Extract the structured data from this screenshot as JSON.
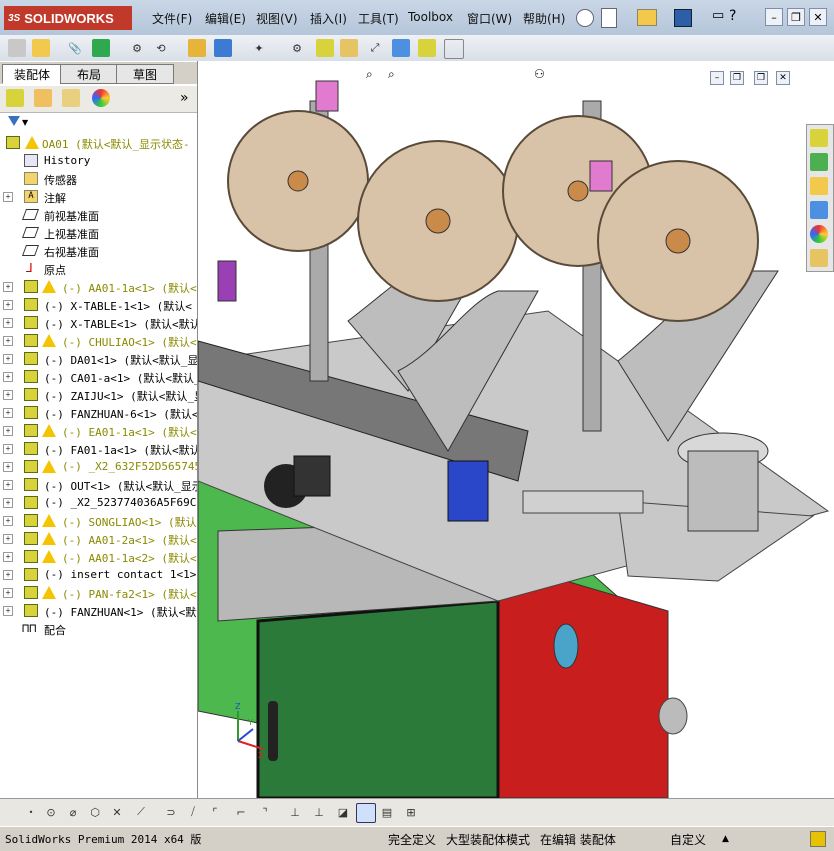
{
  "app": {
    "logo_text": "SOLIDWORKS",
    "logo_prefix": "3S"
  },
  "menu": [
    "文件(F)",
    "编辑(E)",
    "视图(V)",
    "插入(I)",
    "工具(T)",
    "Toolbox",
    "窗口(W)",
    "帮助(H)"
  ],
  "window_buttons": {
    "help": "?",
    "minimize": "–",
    "restore": "❐",
    "close": "✕"
  },
  "tabs": [
    "装配体",
    "布局",
    "草图"
  ],
  "panel_more": "»",
  "tree": {
    "root": "OA01  (默认<默认_显示状态-",
    "features": [
      "History",
      "传感器",
      "注解",
      "前视基准面",
      "上视基准面",
      "右视基准面",
      "原点"
    ],
    "components": [
      {
        "label": "(-) AA01-1a<1> (默认<默",
        "warn": true
      },
      {
        "label": "(-) X-TABLE-1<1> (默认<",
        "warn": false
      },
      {
        "label": "(-) X-TABLE<1> (默认<默认_",
        "warn": false
      },
      {
        "label": "(-) CHULIAO<1> (默认<默认",
        "warn": true
      },
      {
        "label": "(-) DA01<1> (默认<默认_显",
        "warn": false
      },
      {
        "label": "(-) CA01-a<1> (默认<默认_",
        "warn": false
      },
      {
        "label": "(-) ZAIJU<1> (默认<默认_显",
        "warn": false
      },
      {
        "label": "(-) FANZHUAN-6<1> (默认<默",
        "warn": false
      },
      {
        "label": "(-) EA01-1a<1> (默认<默认",
        "warn": true
      },
      {
        "label": "(-) FA01-1a<1> (默认<默认_",
        "warn": false
      },
      {
        "label": "(-) _X2_632F52D5657452",
        "warn": true
      },
      {
        "label": "(-) OUT<1> (默认<默认_显示",
        "warn": false
      },
      {
        "label": "(-) _X2_523774036A5F69CB_",
        "warn": false
      },
      {
        "label": "(-) SONGLIAO<1> (默认<默",
        "warn": true
      },
      {
        "label": "(-) AA01-2a<1> (默认<默认",
        "warn": true
      },
      {
        "label": "(-) AA01-1a<2> (默认<默认",
        "warn": true
      },
      {
        "label": "(-) insert contact 1<1> (",
        "warn": false
      },
      {
        "label": "(-) PAN-fa2<1> (默认<默认",
        "warn": true
      },
      {
        "label": "(-) FANZHUAN<1> (默认<默认",
        "warn": false
      }
    ],
    "mates": "配合"
  },
  "status": {
    "product": "SolidWorks Premium 2014 x64 版",
    "fields": [
      "完全定义",
      "大型装配体模式",
      "在编辑 装配体",
      "自定义"
    ],
    "custom_arrow": "▲"
  },
  "triad": {
    "x": "X",
    "y": "Y",
    "z": "Z"
  },
  "colors": {
    "accent": "#c0392b",
    "machine_green": "#22c432",
    "machine_red": "#c81e1e",
    "reel": "#d8c2a8",
    "panel_green": "#2b7a3a"
  }
}
